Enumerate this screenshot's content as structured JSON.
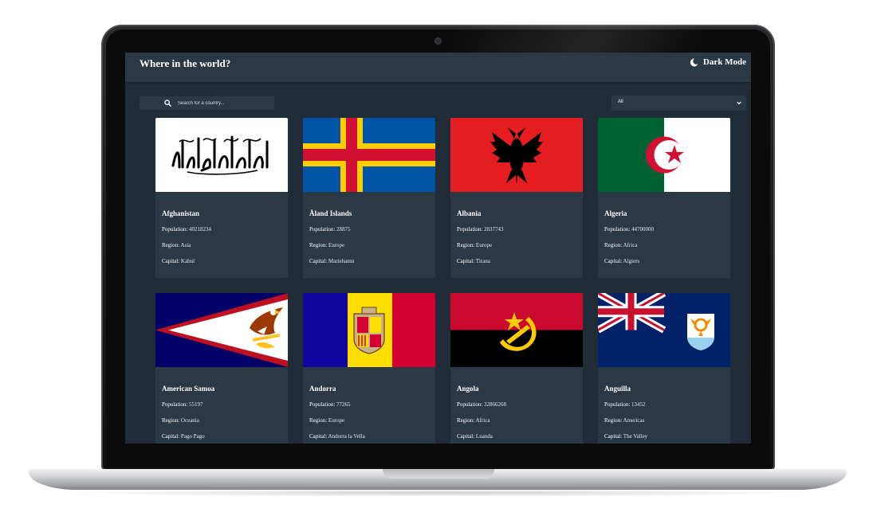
{
  "header": {
    "title": "Where in the world?",
    "theme_label": "Dark Mode"
  },
  "search": {
    "placeholder": "Search for a country..."
  },
  "filter": {
    "selected": "All"
  },
  "labels": {
    "population": "Population:",
    "region": "Region:",
    "capital": "Capital:"
  },
  "countries": [
    {
      "name": "Afghanistan",
      "population": "40218234",
      "region": "Asia",
      "capital": "Kabul",
      "flag": "afghanistan-flag"
    },
    {
      "name": "Åland Islands",
      "population": "28875",
      "region": "Europe",
      "capital": "Mariehamn",
      "flag": "aland-flag"
    },
    {
      "name": "Albania",
      "population": "2837743",
      "region": "Europe",
      "capital": "Tirana",
      "flag": "albania-flag"
    },
    {
      "name": "Algeria",
      "population": "44700000",
      "region": "Africa",
      "capital": "Algiers",
      "flag": "algeria-flag"
    },
    {
      "name": "American Samoa",
      "population": "55197",
      "region": "Oceania",
      "capital": "Pago Pago",
      "flag": "american-samoa-flag"
    },
    {
      "name": "Andorra",
      "population": "77265",
      "region": "Europe",
      "capital": "Andorra la Vella",
      "flag": "andorra-flag"
    },
    {
      "name": "Angola",
      "population": "32866268",
      "region": "Africa",
      "capital": "Luanda",
      "flag": "angola-flag"
    },
    {
      "name": "Anguilla",
      "population": "13452",
      "region": "Americas",
      "capital": "The Valley",
      "flag": "anguilla-flag"
    }
  ],
  "colors": {
    "background": "#202c37",
    "element": "#2b3945",
    "text": "#ffffff"
  }
}
